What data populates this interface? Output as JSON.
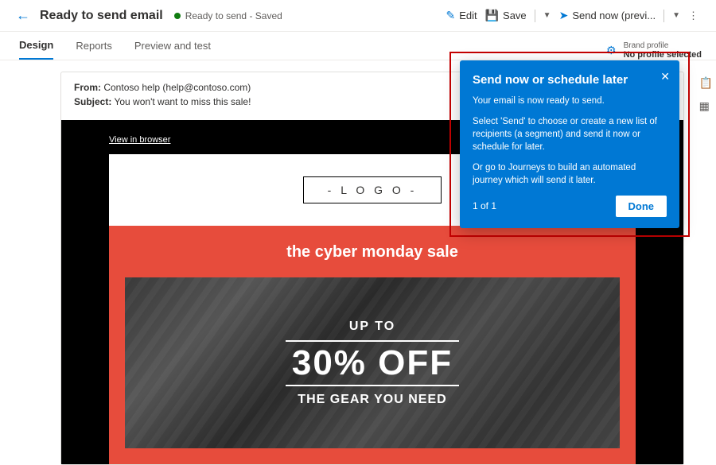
{
  "header": {
    "title": "Ready to send email",
    "status": "Ready to send - Saved",
    "actions": {
      "edit": "Edit",
      "save": "Save",
      "send": "Send now (previ..."
    }
  },
  "tabs": {
    "design": "Design",
    "reports": "Reports",
    "preview": "Preview and test"
  },
  "brand": {
    "label": "Brand profile",
    "value": "No profile selected"
  },
  "email": {
    "from_label": "From:",
    "from_value": "Contoso help (help@contoso.com)",
    "subject_label": "Subject:",
    "subject_value": "You won't want to miss this sale!"
  },
  "preview": {
    "view_in_browser": "View in browser",
    "logo": "- L O G O -",
    "sale_title": "the cyber monday sale",
    "up_to": "UP TO",
    "pct": "30% OFF",
    "gear": "THE GEAR YOU NEED"
  },
  "callout": {
    "title": "Send now or schedule later",
    "line1": "Your email is now ready to send.",
    "line2": "Select 'Send' to choose or create a new list of recipients (a segment) and send it now or schedule for later.",
    "line3": "Or go to Journeys to build an automated journey which will send it later.",
    "step": "1 of 1",
    "done": "Done"
  }
}
